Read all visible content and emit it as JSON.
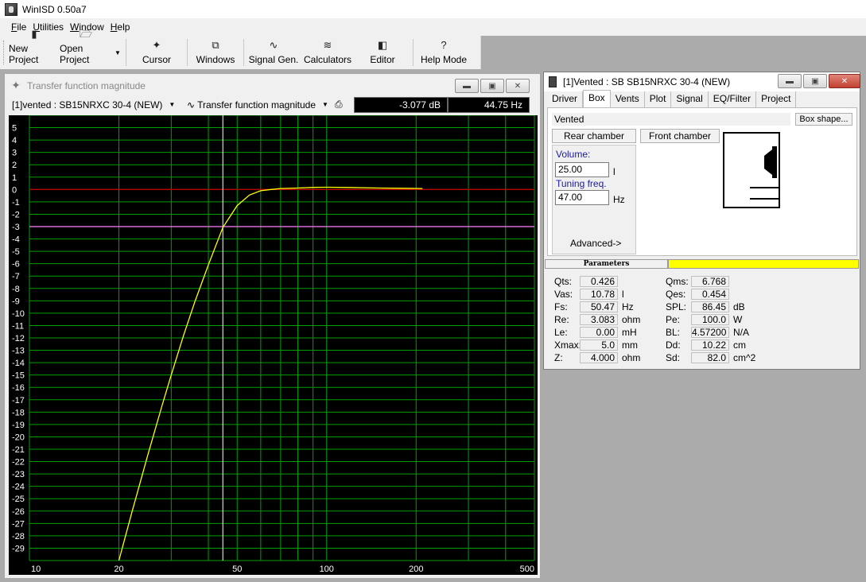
{
  "app": {
    "title": "WinISD 0.50a7"
  },
  "menu": [
    "File",
    "Utilities",
    "Window",
    "Help"
  ],
  "toolbar": {
    "buttons": [
      {
        "label": "New Project",
        "icon": "new-project-icon"
      },
      {
        "label": "Open Project",
        "icon": "open-folder-icon"
      },
      {
        "label": "Cursor",
        "icon": "cursor-icon"
      },
      {
        "label": "Windows",
        "icon": "windows-icon"
      },
      {
        "label": "Signal Gen.",
        "icon": "signal-generator-icon"
      },
      {
        "label": "Calculators",
        "icon": "calculator-icon"
      },
      {
        "label": "Editor",
        "icon": "editor-icon"
      },
      {
        "label": "Help Mode",
        "icon": "help-icon"
      }
    ]
  },
  "chart_window": {
    "title": "Transfer function magnitude",
    "project_select": "[1]vented : SB15NRXC 30-4 (NEW)",
    "graph_select": "Transfer function magnitude",
    "readout_db": "-3.077 dB",
    "readout_hz": "44.75 Hz"
  },
  "chart_data": {
    "type": "line",
    "xscale": "log",
    "xlim": [
      10,
      500
    ],
    "ylim": [
      -30,
      6
    ],
    "x_ticks": [
      "10",
      "20",
      "50",
      "100",
      "200",
      "500"
    ],
    "y_ticks": [
      "5",
      "4",
      "3",
      "2",
      "1",
      "0",
      "-1",
      "-2",
      "-3",
      "-4",
      "-5",
      "-6",
      "-7",
      "-8",
      "-9",
      "-10",
      "-11",
      "-12",
      "-13",
      "-14",
      "-15",
      "-16",
      "-17",
      "-18",
      "-19",
      "-20",
      "-21",
      "-22",
      "-23",
      "-24",
      "-25",
      "-26",
      "-27",
      "-28",
      "-29"
    ],
    "reference_lines": [
      {
        "y": 0,
        "color": "#c00000"
      },
      {
        "y": -3,
        "color": "#ff80ff"
      }
    ],
    "cursor_x": 44.75,
    "series": [
      {
        "color": "#ffff00",
        "x": [
          20,
          22,
          25,
          28,
          30,
          33,
          36,
          40,
          44.75,
          50,
          55,
          60,
          65,
          70,
          80,
          90,
          100,
          120,
          150,
          180,
          210
        ],
        "y": [
          -30,
          -26.3,
          -21.5,
          -17.4,
          -15.0,
          -11.8,
          -9.1,
          -6.1,
          -3.077,
          -1.3,
          -0.45,
          -0.1,
          0.0,
          0.08,
          0.12,
          0.17,
          0.18,
          0.16,
          0.12,
          0.1,
          0.08
        ]
      }
    ],
    "colors": {
      "background": "#000000",
      "grid": "#00a000",
      "curve": "#ffff00",
      "cursor": "#ffffff"
    }
  },
  "box_window": {
    "title": "[1]Vented : SB SB15NRXC 30-4 (NEW)",
    "tabs": [
      "Driver",
      "Box",
      "Vents",
      "Plot",
      "Signal",
      "EQ/Filter",
      "Project"
    ],
    "active_tab": "Box",
    "box_type": "Vented",
    "box_shape_button": "Box shape...",
    "rear_chamber": "Rear chamber",
    "front_chamber": "Front chamber",
    "volume_label": "Volume:",
    "volume_value": "25.00",
    "volume_unit": "l",
    "tuning_label": "Tuning freq.",
    "tuning_value": "47.00",
    "tuning_unit": "Hz",
    "advanced": "Advanced->"
  },
  "parameters": {
    "header": "Parameters",
    "left": [
      {
        "label": "Qts:",
        "value": "0.426",
        "unit": ""
      },
      {
        "label": "Vas:",
        "value": "10.78",
        "unit": "l"
      },
      {
        "label": "Fs:",
        "value": "50.47",
        "unit": "Hz"
      },
      {
        "label": "Re:",
        "value": "3.083",
        "unit": "ohm"
      },
      {
        "label": "Le:",
        "value": "0.00",
        "unit": "mH"
      },
      {
        "label": "Xmax:",
        "value": "5.0",
        "unit": "mm"
      },
      {
        "label": "Z:",
        "value": "4.000",
        "unit": "ohm"
      }
    ],
    "right": [
      {
        "label": "Qms:",
        "value": "6.768",
        "unit": ""
      },
      {
        "label": "Qes:",
        "value": "0.454",
        "unit": ""
      },
      {
        "label": "SPL:",
        "value": "86.45",
        "unit": "dB"
      },
      {
        "label": "Pe:",
        "value": "100.0",
        "unit": "W"
      },
      {
        "label": "BL:",
        "value": "4.57200",
        "unit": "N/A"
      },
      {
        "label": "Dd:",
        "value": "10.22",
        "unit": "cm"
      },
      {
        "label": "Sd:",
        "value": "82.0",
        "unit": "cm^2"
      }
    ]
  }
}
